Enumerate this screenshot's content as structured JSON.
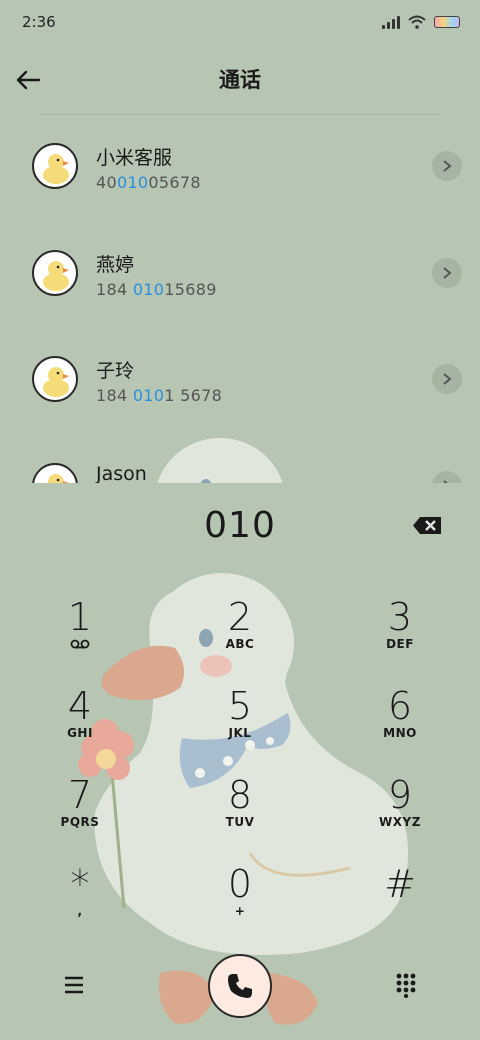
{
  "status_bar": {
    "time": "2:36",
    "icons": [
      "signal-icon",
      "wifi-icon",
      "battery-icon"
    ]
  },
  "header": {
    "title": "通话",
    "back_icon": "back-arrow-icon"
  },
  "contacts": [
    {
      "name": "小米客服",
      "number_pre": "40",
      "number_match": "010",
      "number_post": "05678"
    },
    {
      "name": "燕婷",
      "number_pre": "184 ",
      "number_match": "010",
      "number_post": "15689"
    },
    {
      "name": "子玲",
      "number_pre": "184 ",
      "number_match": "010",
      "number_post": "1 5678"
    },
    {
      "name": "Jason",
      "number_pre": "",
      "number_match": "",
      "number_post": ""
    }
  ],
  "dialpad": {
    "typed": "010",
    "keys": [
      {
        "digit": "1",
        "letters": ""
      },
      {
        "digit": "2",
        "letters": "ABC"
      },
      {
        "digit": "3",
        "letters": "DEF"
      },
      {
        "digit": "4",
        "letters": "GHI"
      },
      {
        "digit": "5",
        "letters": "JKL"
      },
      {
        "digit": "6",
        "letters": "MNO"
      },
      {
        "digit": "7",
        "letters": "PQRS"
      },
      {
        "digit": "8",
        "letters": "TUV"
      },
      {
        "digit": "9",
        "letters": "WXYZ"
      },
      {
        "digit": "*",
        "letters": ","
      },
      {
        "digit": "0",
        "letters": "+"
      },
      {
        "digit": "#",
        "letters": ""
      }
    ]
  },
  "bottom_bar": {
    "menu_icon": "menu-icon",
    "call_icon": "phone-icon",
    "keypad_icon": "dialpad-grid-icon"
  },
  "colors": {
    "background": "#b7c6b2",
    "highlight": "#2a8fe0"
  }
}
